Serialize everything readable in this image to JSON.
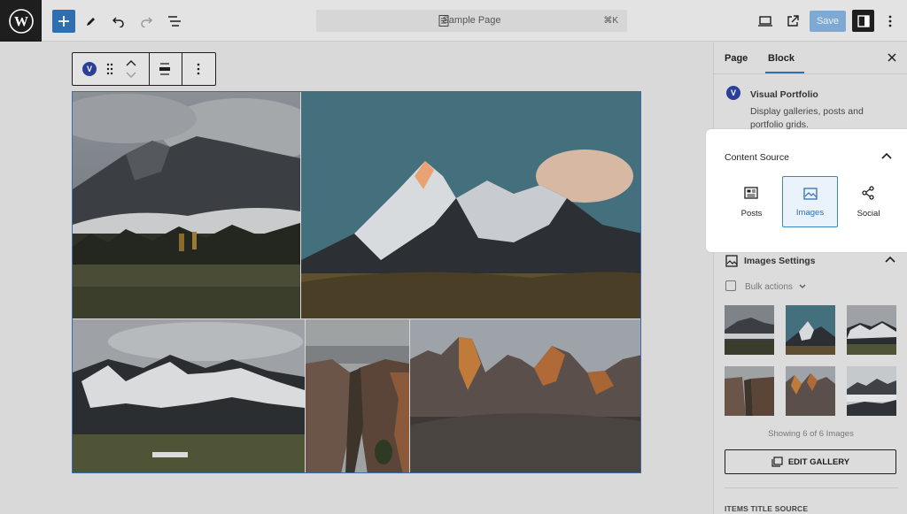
{
  "topbar": {
    "document_title": "Sample Page",
    "shortcut": "⌘K",
    "save_label": "Save",
    "icons": [
      "wordpress-logo",
      "plus-icon",
      "pencil-icon",
      "undo-icon",
      "redo-icon",
      "list-view-icon",
      "document-icon",
      "desktop-preview-icon",
      "external-link-icon",
      "sidebar-icon",
      "more-vertical-icon"
    ]
  },
  "block_toolbar": {
    "block_icon_letter": "V",
    "icons": [
      "visual-portfolio-icon",
      "drag-handle-icon",
      "move-up-icon",
      "move-down-icon",
      "align-icon",
      "more-options-icon"
    ]
  },
  "gallery": {
    "images": [
      "Misty mountain ridge",
      "Snow peak at sunset",
      "Snowy mountain range",
      "Rocky canyon",
      "Jagged orange peaks"
    ]
  },
  "sidebar": {
    "tabs": [
      "Page",
      "Block"
    ],
    "active_tab": "Block",
    "plugin_badge_letter": "V",
    "plugin_name": "Visual Portfolio",
    "plugin_description": "Display galleries, posts and portfolio grids.",
    "content_source": {
      "title": "Content Source",
      "options": [
        "Posts",
        "Images",
        "Social"
      ],
      "selected": "Images"
    },
    "images_settings": {
      "title": "Images Settings",
      "bulk_actions": "Bulk actions",
      "showing_text": "Showing 6 of 6 Images",
      "edit_button": "EDIT GALLERY"
    },
    "items_title_source": "ITEMS TITLE SOURCE"
  },
  "colors": {
    "accent": "#2f6fb0",
    "selected_border": "#3b86c9",
    "badge": "#2a3f9a"
  }
}
